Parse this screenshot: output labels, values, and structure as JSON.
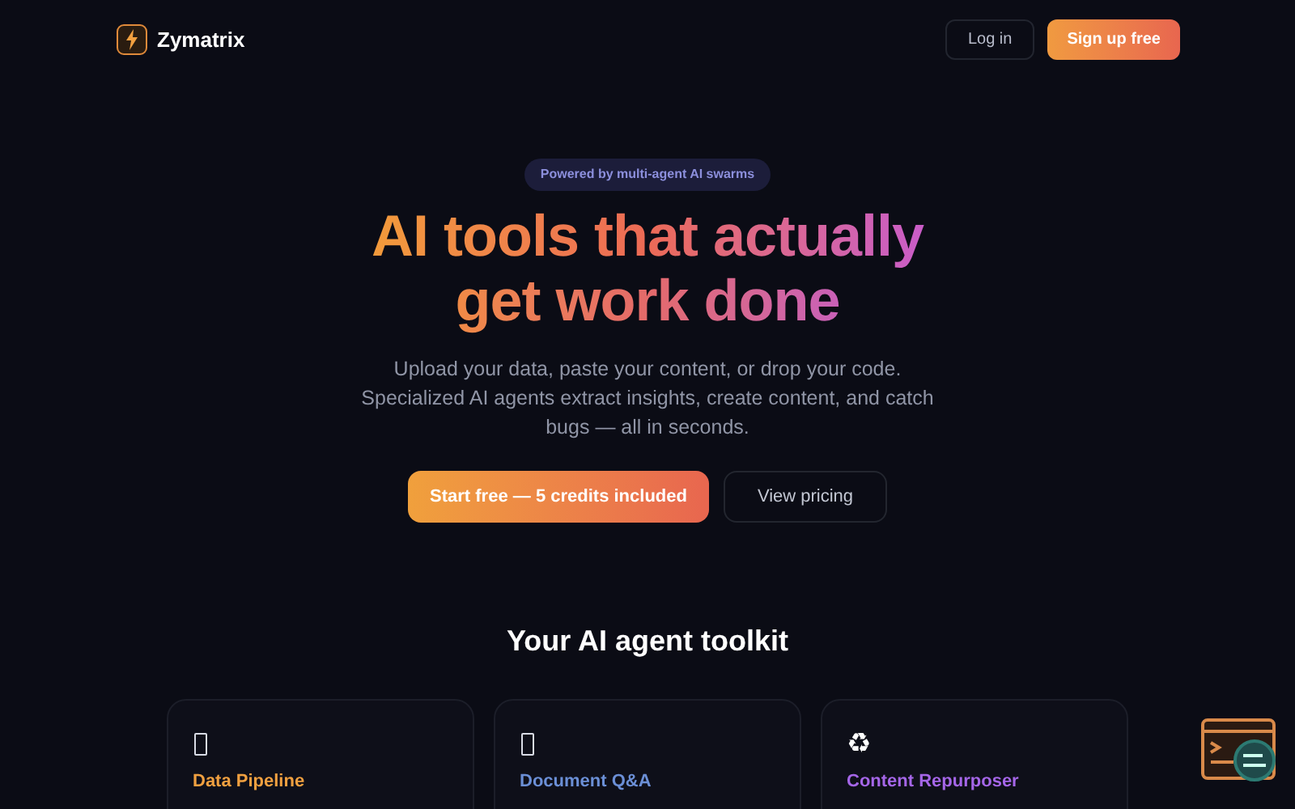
{
  "nav": {
    "brand": "Zymatrix",
    "login": "Log in",
    "signup": "Sign up free"
  },
  "hero": {
    "badge": "Powered by multi-agent AI swarms",
    "headline_lines": [
      "AI tools that actually",
      "get work done"
    ],
    "description": "Upload your data, paste your content, or drop your code. Specialized AI agents extract insights, create content, and catch bugs — all in seconds.",
    "primary_cta": "Start free — 5 credits included",
    "secondary_cta": "View pricing"
  },
  "toolkit": {
    "title": "Your AI agent toolkit",
    "cards": [
      {
        "kind": "box",
        "title": "Data Pipeline",
        "color": "#f0a040"
      },
      {
        "kind": "box",
        "title": "Document Q&A",
        "color": "#6b8fd6"
      },
      {
        "kind": "glyph",
        "icon": "♻",
        "title": "Content Repurposer",
        "color": "#a566e8"
      }
    ]
  }
}
